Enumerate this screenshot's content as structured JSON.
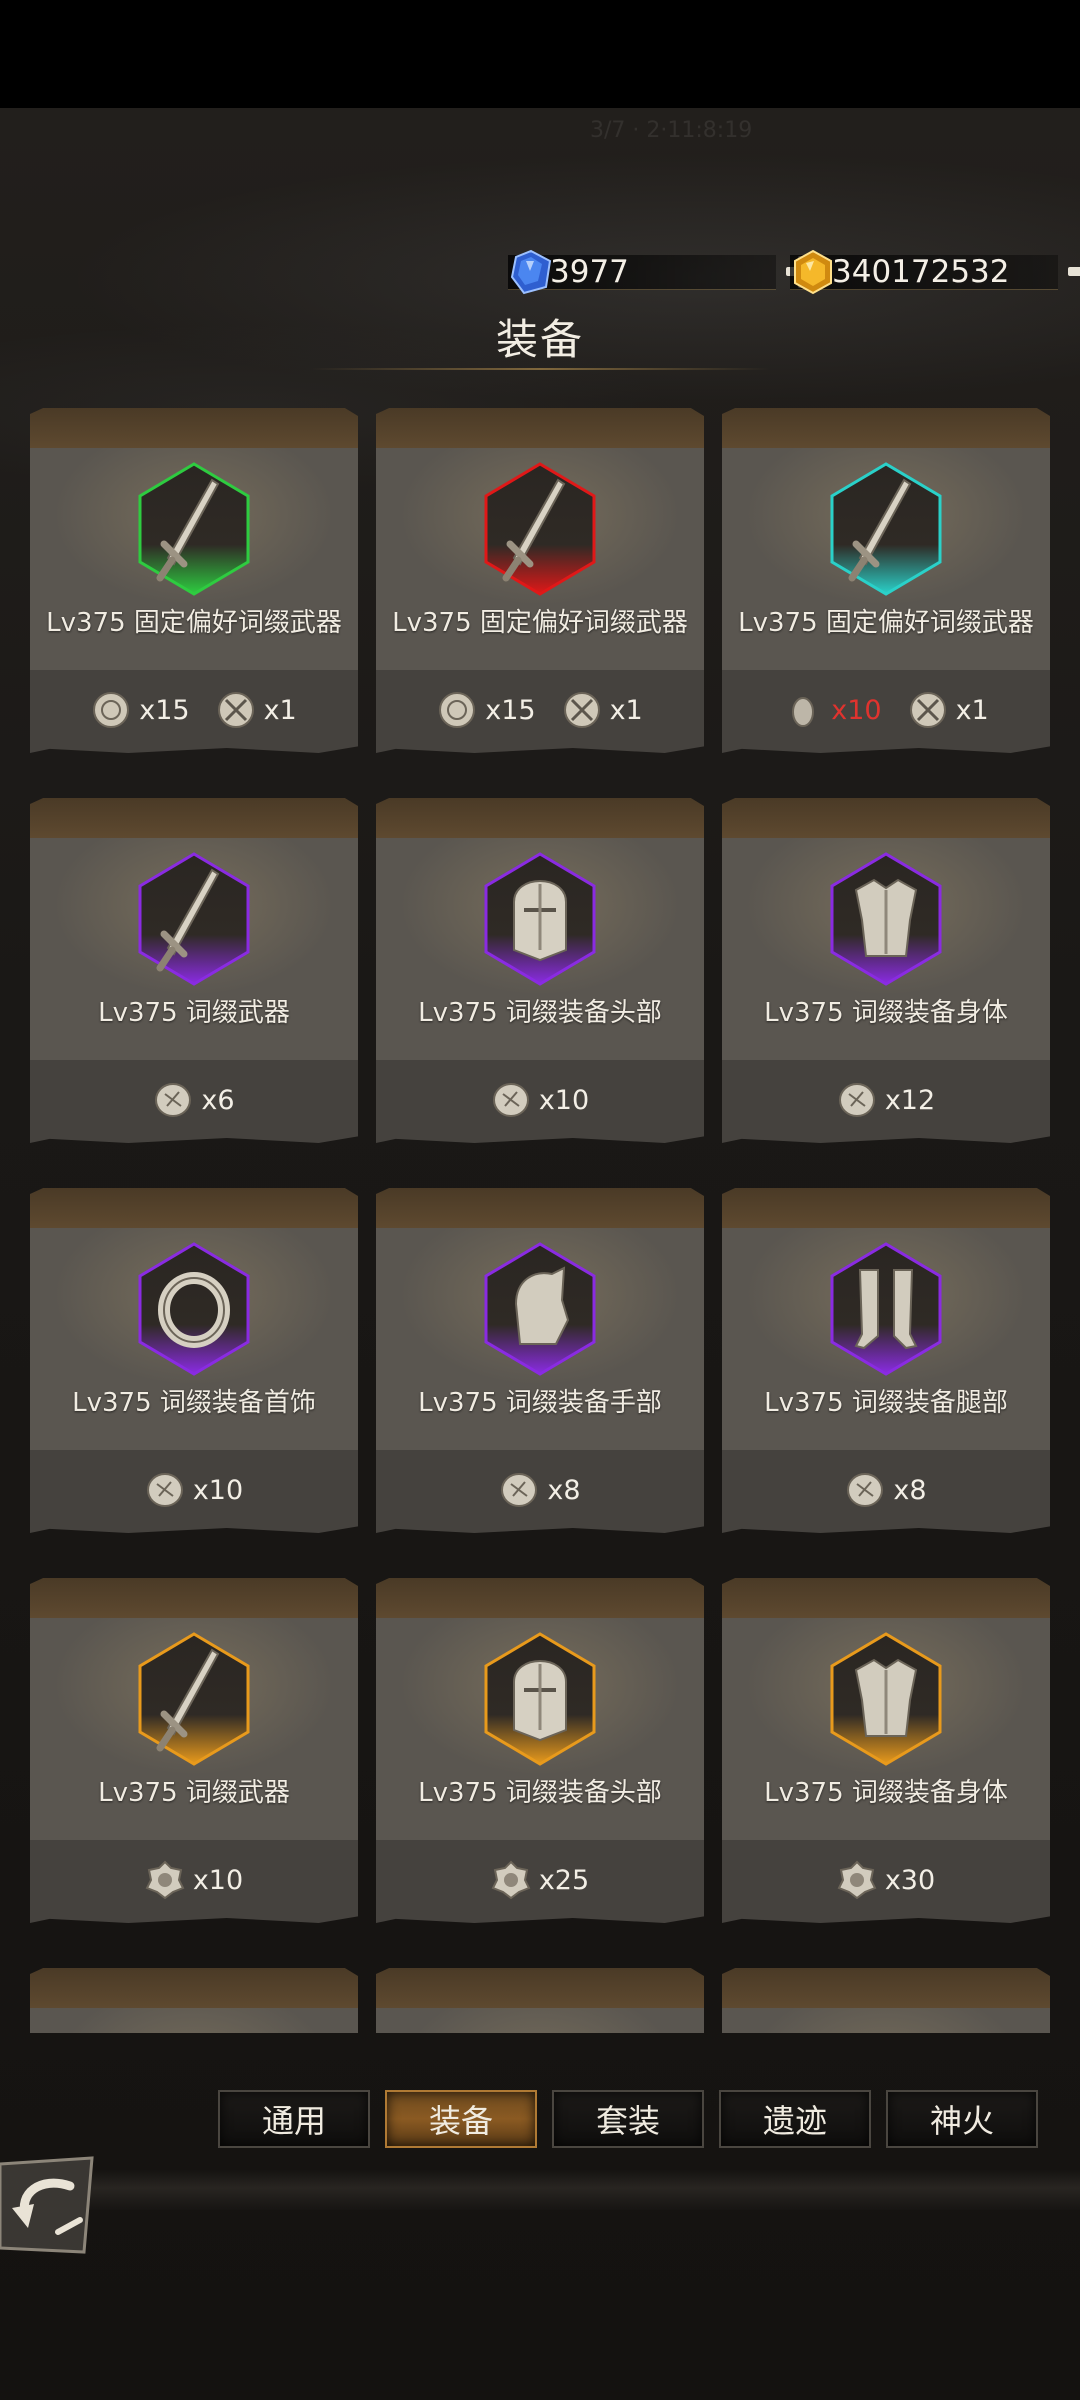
{
  "status_bar": {},
  "header": {
    "ghost_text": "3/7 · 2·11:8:19",
    "currencies": [
      {
        "name": "blue-gem",
        "value": "3977",
        "color": "#3b6fd8"
      },
      {
        "name": "gold-gem",
        "value": "340172532",
        "color": "#e8a418"
      }
    ],
    "title": "装备"
  },
  "cards": [
    {
      "label": "Lv375 固定偏好词缀武器",
      "item": "sword-icon",
      "frame": "#2ecc40",
      "costs": [
        {
          "icon": "medal-icon",
          "qty": "x15",
          "red": false
        },
        {
          "icon": "crossed-swords-coin-icon",
          "qty": "x1",
          "red": false
        }
      ]
    },
    {
      "label": "Lv375 固定偏好词缀武器",
      "item": "sword-icon",
      "frame": "#e01818",
      "costs": [
        {
          "icon": "medal-icon",
          "qty": "x15",
          "red": false
        },
        {
          "icon": "crossed-swords-coin-icon",
          "qty": "x1",
          "red": false
        }
      ]
    },
    {
      "label": "Lv375 固定偏好词缀武器",
      "item": "sword-icon",
      "frame": "#2ad1c9",
      "costs": [
        {
          "icon": "stone-icon",
          "qty": "x10",
          "red": true
        },
        {
          "icon": "crossed-swords-coin-icon",
          "qty": "x1",
          "red": false
        }
      ]
    },
    {
      "label": "Lv375 词缀武器",
      "item": "sword-icon",
      "frame": "#8a2be2",
      "costs": [
        {
          "icon": "scroll-token-icon",
          "qty": "x6",
          "red": false
        }
      ]
    },
    {
      "label": "Lv375 词缀装备头部",
      "item": "helmet-icon",
      "frame": "#8a2be2",
      "costs": [
        {
          "icon": "scroll-token-icon",
          "qty": "x10",
          "red": false
        }
      ]
    },
    {
      "label": "Lv375 词缀装备身体",
      "item": "armor-icon",
      "frame": "#8a2be2",
      "costs": [
        {
          "icon": "scroll-token-icon",
          "qty": "x12",
          "red": false
        }
      ]
    },
    {
      "label": "Lv375 词缀装备首饰",
      "item": "ring-icon",
      "frame": "#8a2be2",
      "costs": [
        {
          "icon": "scroll-token-icon",
          "qty": "x10",
          "red": false
        }
      ]
    },
    {
      "label": "Lv375 词缀装备手部",
      "item": "gauntlet-icon",
      "frame": "#8a2be2",
      "costs": [
        {
          "icon": "scroll-token-icon",
          "qty": "x8",
          "red": false
        }
      ]
    },
    {
      "label": "Lv375 词缀装备腿部",
      "item": "greaves-icon",
      "frame": "#8a2be2",
      "costs": [
        {
          "icon": "scroll-token-icon",
          "qty": "x8",
          "red": false
        }
      ]
    },
    {
      "label": "Lv375 词缀武器",
      "item": "sword-icon",
      "frame": "#e89a1c",
      "costs": [
        {
          "icon": "gear-token-icon",
          "qty": "x10",
          "red": false
        }
      ]
    },
    {
      "label": "Lv375 词缀装备头部",
      "item": "helmet-icon",
      "frame": "#e89a1c",
      "costs": [
        {
          "icon": "gear-token-icon",
          "qty": "x25",
          "red": false
        }
      ]
    },
    {
      "label": "Lv375 词缀装备身体",
      "item": "armor-icon",
      "frame": "#e89a1c",
      "costs": [
        {
          "icon": "gear-token-icon",
          "qty": "x30",
          "red": false
        }
      ]
    },
    {
      "label": "",
      "item": "",
      "frame": "#e89a1c",
      "costs": []
    },
    {
      "label": "",
      "item": "",
      "frame": "#e89a1c",
      "costs": []
    },
    {
      "label": "",
      "item": "",
      "frame": "#e89a1c",
      "costs": []
    }
  ],
  "tabs": [
    {
      "label": "通用",
      "active": false
    },
    {
      "label": "装备",
      "active": true
    },
    {
      "label": "套装",
      "active": false
    },
    {
      "label": "遗迹",
      "active": false
    },
    {
      "label": "神火",
      "active": false
    }
  ],
  "back_button": {
    "icon": "back-arrow-icon"
  }
}
